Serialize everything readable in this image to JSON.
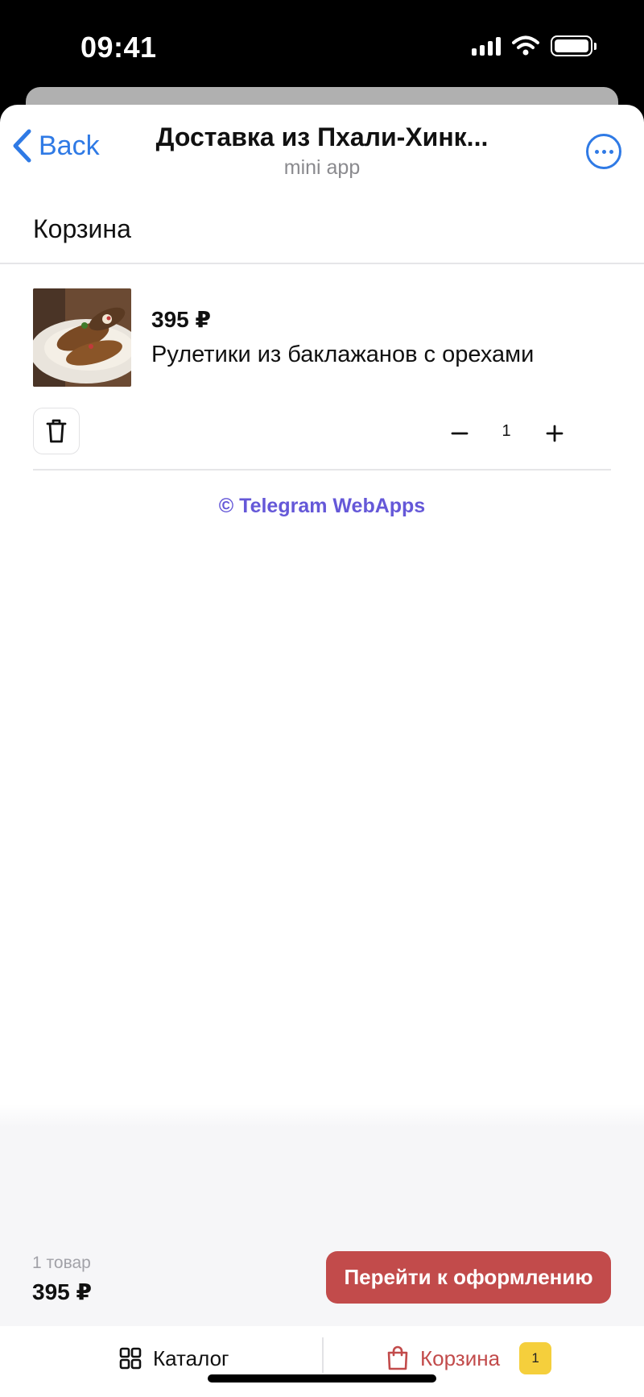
{
  "status_bar": {
    "time": "09:41"
  },
  "header": {
    "back_label": "Back",
    "title": "Доставка из Пхали-Хинк...",
    "subtitle": "mini app"
  },
  "page": {
    "section_title": "Корзина"
  },
  "cart": {
    "items": [
      {
        "price": "395 ₽",
        "name": "Рулетики из баклажанов с орехами",
        "quantity": "1"
      }
    ]
  },
  "footer": {
    "link": "© Telegram WebApps"
  },
  "summary": {
    "count": "1 товар",
    "total": "395 ₽",
    "checkout_label": "Перейти к оформлению"
  },
  "tabbar": {
    "catalog_label": "Каталог",
    "cart_label": "Корзина",
    "cart_badge": "1"
  },
  "colors": {
    "accent_blue": "#2f7ae5",
    "checkout_red": "#c24b4b",
    "link_purple": "#6558d8",
    "badge_yellow": "#f5cf3c"
  },
  "icons": [
    "chevron-left-icon",
    "more-icon",
    "trash-icon",
    "minus-icon",
    "plus-icon",
    "grid-icon",
    "bag-icon"
  ]
}
